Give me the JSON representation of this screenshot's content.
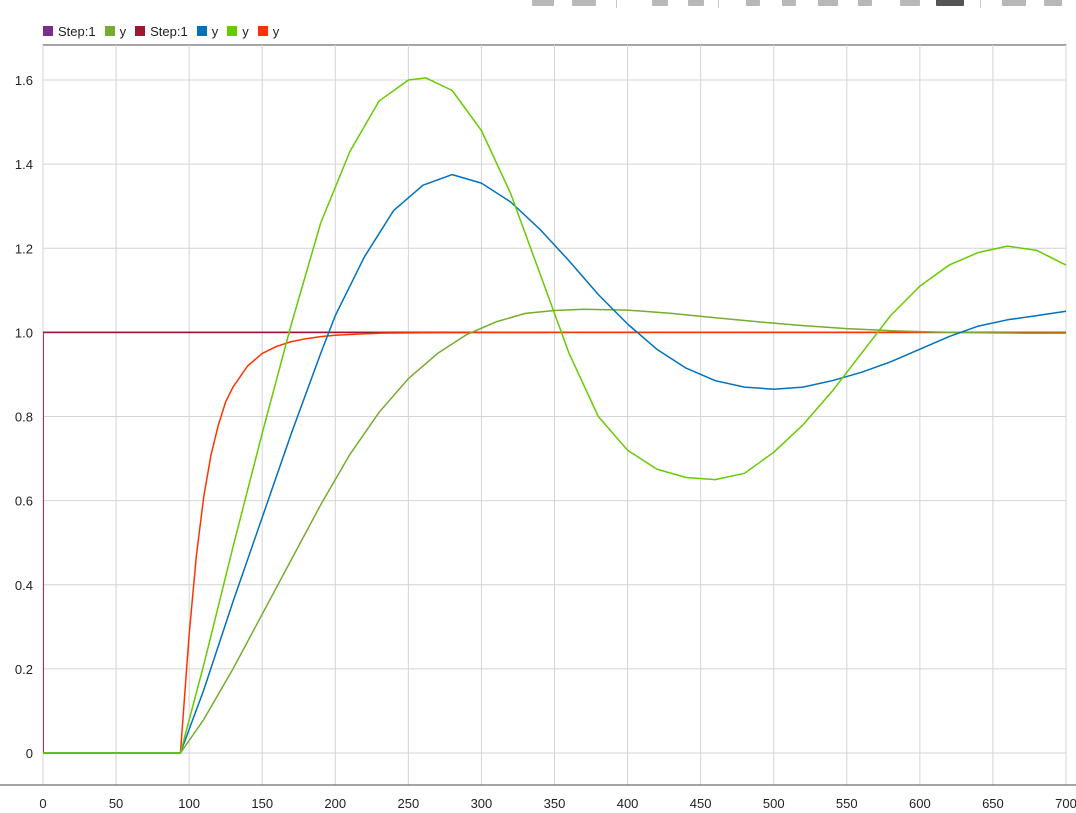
{
  "toolbar": {
    "icons": [
      "layout-icon",
      "cursor-measure-icon",
      "zoom-in-icon",
      "zoom-x-icon",
      "pan-icon",
      "zoom-fit-icon",
      "zoom-y-icon",
      "autoscale-icon",
      "select-icon",
      "settings-icon",
      "gear-icon"
    ]
  },
  "chart_data": {
    "type": "line",
    "title": "",
    "xlabel": "",
    "ylabel": "",
    "xlim": [
      0,
      700
    ],
    "ylim": [
      -0.05,
      1.68
    ],
    "grid": true,
    "legend_placement": "top-left",
    "x_ticks": [
      0,
      50,
      100,
      150,
      200,
      250,
      300,
      350,
      400,
      450,
      500,
      550,
      600,
      650,
      700
    ],
    "x_tick_labels": [
      "0",
      "50",
      "100",
      "150",
      "200",
      "250",
      "300",
      "350",
      "400",
      "450",
      "500",
      "550",
      "600",
      "650",
      "700"
    ],
    "y_ticks": [
      0,
      0.2,
      0.4,
      0.6,
      0.8,
      1.0,
      1.2,
      1.4,
      1.6
    ],
    "y_tick_labels": [
      "0",
      "0.2",
      "0.4",
      "0.6",
      "0.8",
      "1.0",
      "1.2",
      "1.4",
      "1.6"
    ],
    "legend": [
      {
        "label": "Step:1",
        "color": "#7b2d8e"
      },
      {
        "label": "y",
        "color": "#77ac30"
      },
      {
        "label": "Step:1",
        "color": "#a2142f"
      },
      {
        "label": "y",
        "color": "#0072bd"
      },
      {
        "label": "y",
        "color": "#66cc00"
      },
      {
        "label": "y",
        "color": "#ff3300"
      }
    ],
    "series": [
      {
        "name": "Step:1",
        "color": "#7b2d8e",
        "x": [
          0,
          0,
          700
        ],
        "y": [
          0,
          1.0,
          1.0
        ]
      },
      {
        "name": "Step:1",
        "color": "#a2142f",
        "x": [
          0,
          0,
          345
        ],
        "y": [
          0,
          1.0,
          1.0
        ]
      },
      {
        "name": "y",
        "color": "#ff3300",
        "x": [
          0,
          94,
          100,
          105,
          110,
          115,
          120,
          125,
          130,
          140,
          150,
          160,
          170,
          180,
          190,
          200,
          215,
          230,
          260,
          300,
          350,
          400,
          500,
          600,
          700
        ],
        "y": [
          0,
          0,
          0.28,
          0.47,
          0.61,
          0.71,
          0.78,
          0.835,
          0.87,
          0.92,
          0.95,
          0.967,
          0.978,
          0.985,
          0.99,
          0.993,
          0.996,
          0.998,
          0.999,
          1.0,
          1.0,
          1.0,
          1.0,
          1.0,
          1.0
        ]
      },
      {
        "name": "y",
        "color": "#77ac30",
        "x": [
          0,
          94,
          110,
          130,
          150,
          170,
          190,
          210,
          230,
          250,
          270,
          290,
          310,
          330,
          350,
          370,
          400,
          430,
          460,
          490,
          520,
          550,
          580,
          610,
          640,
          670,
          700
        ],
        "y": [
          0,
          0,
          0.08,
          0.2,
          0.33,
          0.46,
          0.59,
          0.71,
          0.81,
          0.89,
          0.95,
          0.995,
          1.025,
          1.045,
          1.052,
          1.055,
          1.053,
          1.045,
          1.035,
          1.025,
          1.016,
          1.009,
          1.004,
          1.001,
          0.999,
          0.998,
          0.998
        ]
      },
      {
        "name": "y",
        "color": "#0072bd",
        "x": [
          0,
          94,
          110,
          130,
          150,
          170,
          190,
          200,
          220,
          240,
          260,
          280,
          300,
          320,
          340,
          360,
          380,
          400,
          420,
          440,
          460,
          480,
          500,
          520,
          540,
          560,
          580,
          600,
          620,
          640,
          660,
          680,
          700
        ],
        "y": [
          0,
          0,
          0.15,
          0.36,
          0.56,
          0.76,
          0.95,
          1.04,
          1.18,
          1.29,
          1.35,
          1.375,
          1.355,
          1.31,
          1.245,
          1.17,
          1.09,
          1.02,
          0.96,
          0.915,
          0.885,
          0.87,
          0.865,
          0.87,
          0.885,
          0.905,
          0.93,
          0.96,
          0.99,
          1.015,
          1.03,
          1.04,
          1.05
        ]
      },
      {
        "name": "y",
        "color": "#66cc00",
        "x": [
          0,
          94,
          110,
          130,
          150,
          170,
          190,
          210,
          230,
          250,
          262,
          280,
          300,
          320,
          340,
          360,
          380,
          400,
          420,
          440,
          460,
          480,
          500,
          520,
          540,
          560,
          580,
          600,
          620,
          640,
          660,
          680,
          700
        ],
        "y": [
          0,
          0,
          0.21,
          0.49,
          0.76,
          1.02,
          1.26,
          1.43,
          1.55,
          1.6,
          1.605,
          1.575,
          1.48,
          1.33,
          1.14,
          0.95,
          0.8,
          0.72,
          0.675,
          0.655,
          0.65,
          0.665,
          0.715,
          0.78,
          0.86,
          0.95,
          1.04,
          1.11,
          1.16,
          1.19,
          1.205,
          1.195,
          1.16
        ]
      }
    ]
  }
}
